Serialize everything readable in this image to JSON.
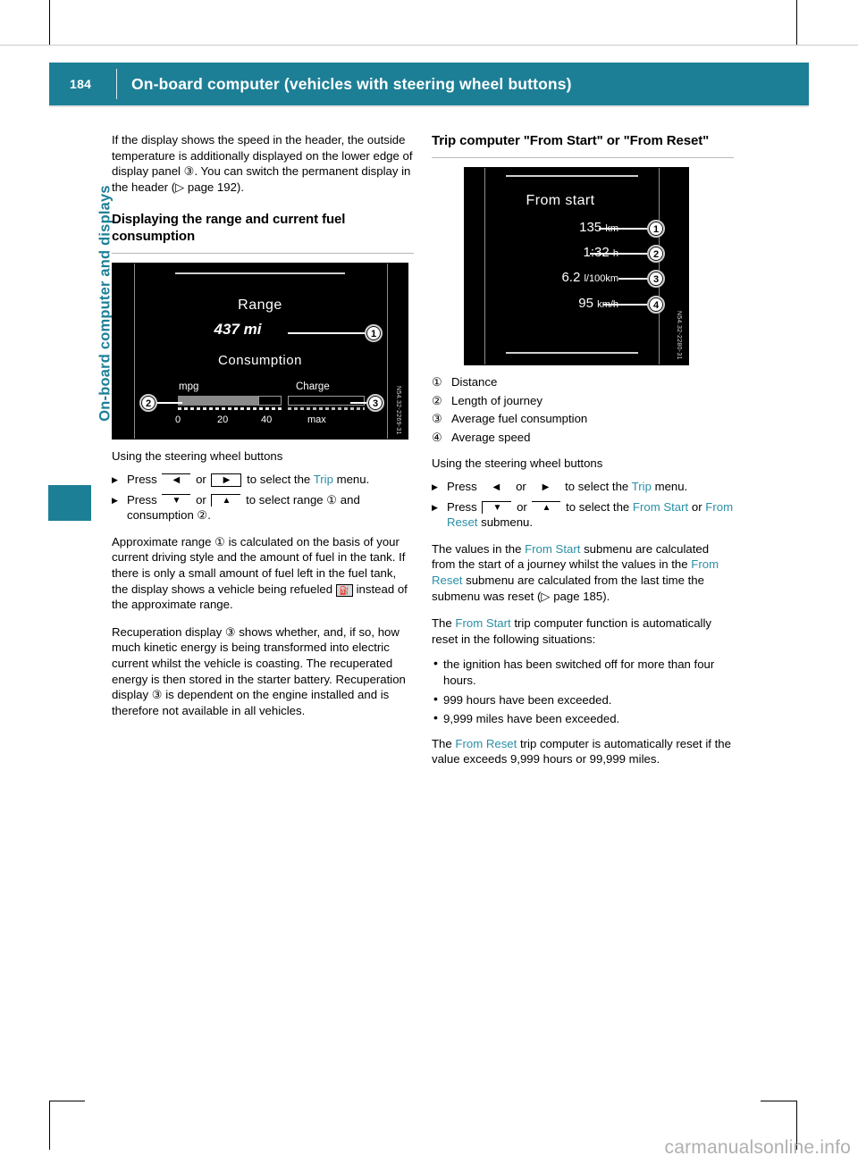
{
  "page": {
    "number": "184",
    "title": "On-board computer (vehicles with steering wheel buttons)",
    "side_tab_title": "On-board computer and displays",
    "watermark": "carmanualsonline.info",
    "accent_color": "#1d7f96",
    "link_color": "#2a8fa6"
  },
  "left_column": {
    "intro_paragraph": "If the display shows the speed in the header, the outside temperature is additionally displayed on the lower edge of display panel ③. You can switch the permanent display in the header (▷ page 192).",
    "heading": "Displaying the range and current fuel consumption",
    "figure": {
      "title": "Range",
      "range_value": "437 mi",
      "consumption_label": "Consumption",
      "left_scale_label": "mpg",
      "right_scale_label": "Charge",
      "ticks": [
        "0",
        "20",
        "40",
        "max"
      ],
      "figure_code": "N54.32-2269-31",
      "callouts": [
        "1",
        "2",
        "3"
      ]
    },
    "steering_heading": "Using the steering wheel buttons",
    "steps": [
      {
        "pre": "Press",
        "key_a": "◀",
        "mid": "or",
        "key_b": "▶",
        "post_before": "to select the",
        "link": "Trip",
        "post_after": "menu."
      },
      {
        "pre": "Press",
        "key_a": "▼",
        "mid": "or",
        "key_b": "▲",
        "post_before": "to select range ① and consumption ②.",
        "link": "",
        "post_after": ""
      }
    ],
    "paragraph_range": "Approximate range ① is calculated on the basis of your current driving style and the amount of fuel in the tank. If there is only a small amount of fuel left in the fuel tank, the display shows a vehicle being refueled",
    "paragraph_range_end": "instead of the approximate range.",
    "refuel_pictogram": "⛽",
    "paragraph_recuperation": "Recuperation display ③ shows whether, and, if so, how much kinetic energy is being transformed into electric current whilst the vehicle is coasting. The recuperated energy is then stored in the starter battery. Recuperation display ③ is dependent on the engine installed and is therefore not available in all vehicles."
  },
  "right_column": {
    "heading": "Trip computer \"From Start\" or \"From Reset\"",
    "figure": {
      "title": "From start",
      "rows": [
        {
          "value": "135",
          "unit": "km"
        },
        {
          "value": "1:32",
          "unit": "h"
        },
        {
          "value": "6.2",
          "unit": "l/100km"
        },
        {
          "value": "95",
          "unit": "km/h"
        }
      ],
      "figure_code": "N54.32-2280-31",
      "callouts": [
        "1",
        "2",
        "3",
        "4"
      ]
    },
    "legend": [
      {
        "num": "①",
        "text": "Distance"
      },
      {
        "num": "②",
        "text": "Length of journey"
      },
      {
        "num": "③",
        "text": "Average fuel consumption"
      },
      {
        "num": "④",
        "text": "Average speed"
      }
    ],
    "steering_heading": "Using the steering wheel buttons",
    "steps": [
      {
        "pre": "Press",
        "key_a": "◀",
        "mid": "or",
        "key_b": "▶",
        "post_before": "to select the",
        "link": "Trip",
        "post_after": "menu."
      },
      {
        "pre": "Press",
        "key_a": "▼",
        "mid": "or",
        "key_b": "▲",
        "post_before": "to select the",
        "link": "From Start",
        "mid2": "or",
        "link2": "From Reset",
        "post_after": "submenu."
      }
    ],
    "paragraph_values_a": "The values in the",
    "paragraph_values_link1": "From Start",
    "paragraph_values_b": "submenu are calculated from the start of a journey whilst the values in the",
    "paragraph_values_link2": "From Reset",
    "paragraph_values_c": "submenu are calculated from the last time the submenu was reset (▷ page 185).",
    "reset_lead_a": "The",
    "reset_lead_link": "From Start",
    "reset_lead_b": "trip computer function is automatically reset in the following situations:",
    "reset_bullets": [
      "the ignition has been switched off for more than four hours.",
      "999 hours have been exceeded.",
      "9,999 miles have been exceeded."
    ],
    "final_a": "The",
    "final_link": "From Reset",
    "final_b": "trip computer is automatically reset if the value exceeds 9,999 hours or 99,999 miles."
  }
}
